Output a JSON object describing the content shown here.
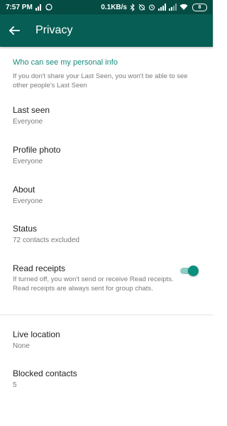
{
  "status_bar": {
    "time": "7:57 PM",
    "net_speed": "0.1KB/s",
    "battery": "8",
    "left_icons": [
      "signal-bars-icon",
      "whatsapp-notification-icon"
    ],
    "right_icons": [
      "bluetooth-icon",
      "alarm-off-icon",
      "alarm-icon",
      "cell-signal-icon",
      "cell-signal-2-icon",
      "wifi-icon",
      "battery-icon"
    ]
  },
  "app_bar": {
    "title": "Privacy",
    "back_icon": "arrow-back-icon"
  },
  "personal_info": {
    "header": "Who can see my personal info",
    "description": "If you don't share your Last Seen, you won't be able to see other people's Last Seen"
  },
  "settings": {
    "last_seen": {
      "title": "Last seen",
      "value": "Everyone"
    },
    "profile_photo": {
      "title": "Profile photo",
      "value": "Everyone"
    },
    "about": {
      "title": "About",
      "value": "Everyone"
    },
    "status": {
      "title": "Status",
      "value": "72 contacts excluded"
    },
    "read_receipts": {
      "title": "Read receipts",
      "description": "If turned off, you won't send or receive Read receipts. Read receipts are always sent for group chats.",
      "enabled": true
    },
    "live_location": {
      "title": "Live location",
      "value": "None"
    },
    "blocked_contacts": {
      "title": "Blocked contacts",
      "value": "5"
    }
  },
  "colors": {
    "status_bar": "#054d44",
    "app_bar": "#075e54",
    "accent": "#1a8a7d",
    "toggle_on": "#0b8f7e"
  }
}
